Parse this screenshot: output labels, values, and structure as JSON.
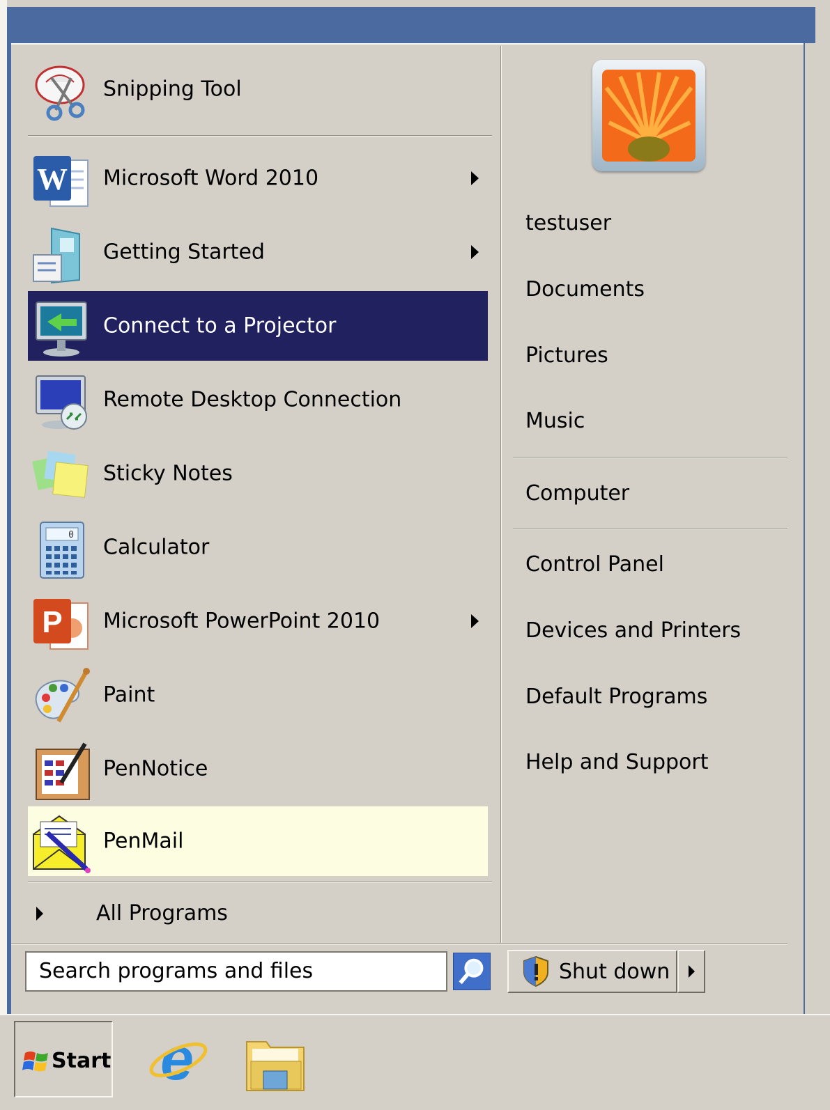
{
  "start_menu": {
    "pinned_items": [
      {
        "label": "Snipping Tool",
        "icon": "scissors-icon",
        "has_submenu": false
      }
    ],
    "recent_items": [
      {
        "label": "Microsoft Word 2010",
        "icon": "word-icon",
        "has_submenu": true
      },
      {
        "label": "Getting Started",
        "icon": "getting-started-icon",
        "has_submenu": true
      },
      {
        "label": "Connect to a Projector",
        "icon": "projector-icon",
        "has_submenu": false,
        "state": "selected"
      },
      {
        "label": "Remote Desktop Connection",
        "icon": "remote-desktop-icon",
        "has_submenu": false
      },
      {
        "label": "Sticky Notes",
        "icon": "sticky-notes-icon",
        "has_submenu": false
      },
      {
        "label": "Calculator",
        "icon": "calculator-icon",
        "has_submenu": false
      },
      {
        "label": "Microsoft PowerPoint 2010",
        "icon": "powerpoint-icon",
        "has_submenu": true
      },
      {
        "label": "Paint",
        "icon": "paint-palette-icon",
        "has_submenu": false
      },
      {
        "label": "PenNotice",
        "icon": "pennotice-icon",
        "has_submenu": false
      },
      {
        "label": "PenMail",
        "icon": "penmail-envelope-icon",
        "has_submenu": false,
        "state": "highlighted"
      }
    ],
    "all_programs_label": "All Programs",
    "search_placeholder": "Search programs and files",
    "right_pane": {
      "user_name": "testuser",
      "places": [
        "Documents",
        "Pictures",
        "Music"
      ],
      "computer": "Computer",
      "system": [
        "Control Panel",
        "Devices and Printers",
        "Default Programs",
        "Help and Support"
      ]
    },
    "shutdown_label": "Shut down"
  },
  "taskbar": {
    "start_label": "Start",
    "pinned": [
      "internet-explorer-icon",
      "windows-explorer-icon"
    ]
  },
  "colors": {
    "menu_frame": "#4a6aa0",
    "menu_background": "#d4d0c8",
    "selected_background": "#22215f",
    "highlight_background": "#fcfde1"
  }
}
